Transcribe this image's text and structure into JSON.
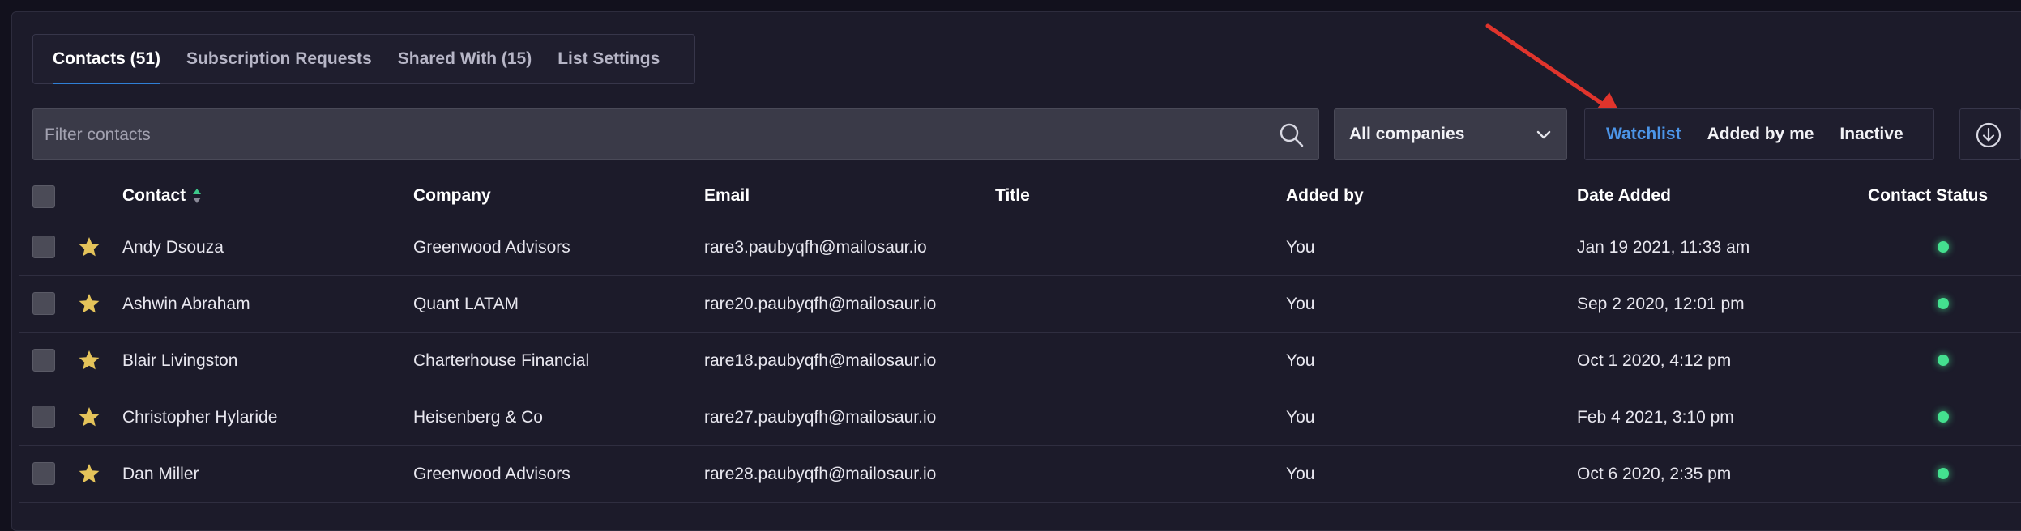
{
  "tabs": [
    {
      "label": "Contacts (51)",
      "active": true
    },
    {
      "label": "Subscription Requests",
      "active": false
    },
    {
      "label": "Shared With (15)",
      "active": false
    },
    {
      "label": "List Settings",
      "active": false
    }
  ],
  "filter": {
    "placeholder": "Filter contacts"
  },
  "company_select": {
    "value": "All companies"
  },
  "view_toggle": [
    {
      "label": "Watchlist",
      "active": true
    },
    {
      "label": "Added by me",
      "active": false
    },
    {
      "label": "Inactive",
      "active": false
    }
  ],
  "table": {
    "columns": {
      "contact": "Contact",
      "company": "Company",
      "email": "Email",
      "title": "Title",
      "added_by": "Added by",
      "date_added": "Date Added",
      "status": "Contact Status"
    },
    "rows": [
      {
        "contact": "Andy Dsouza",
        "company": "Greenwood Advisors",
        "email": "rare3.paubyqfh@mailosaur.io",
        "title": "",
        "added_by": "You",
        "date_added": "Jan 19 2021, 11:33 am"
      },
      {
        "contact": "Ashwin Abraham",
        "company": "Quant LATAM",
        "email": "rare20.paubyqfh@mailosaur.io",
        "title": "",
        "added_by": "You",
        "date_added": "Sep 2 2020, 12:01 pm"
      },
      {
        "contact": "Blair Livingston",
        "company": "Charterhouse Financial",
        "email": "rare18.paubyqfh@mailosaur.io",
        "title": "",
        "added_by": "You",
        "date_added": "Oct 1 2020, 4:12 pm"
      },
      {
        "contact": "Christopher Hylaride",
        "company": "Heisenberg & Co",
        "email": "rare27.paubyqfh@mailosaur.io",
        "title": "",
        "added_by": "You",
        "date_added": "Feb 4 2021, 3:10 pm"
      },
      {
        "contact": "Dan Miller",
        "company": "Greenwood Advisors",
        "email": "rare28.paubyqfh@mailosaur.io",
        "title": "",
        "added_by": "You",
        "date_added": "Oct 6 2020, 2:35 pm"
      }
    ]
  },
  "colors": {
    "accent": "#4c95e8",
    "status_active": "#44e08f",
    "star": "#e4c35a",
    "annotation_arrow": "#e0342c"
  }
}
